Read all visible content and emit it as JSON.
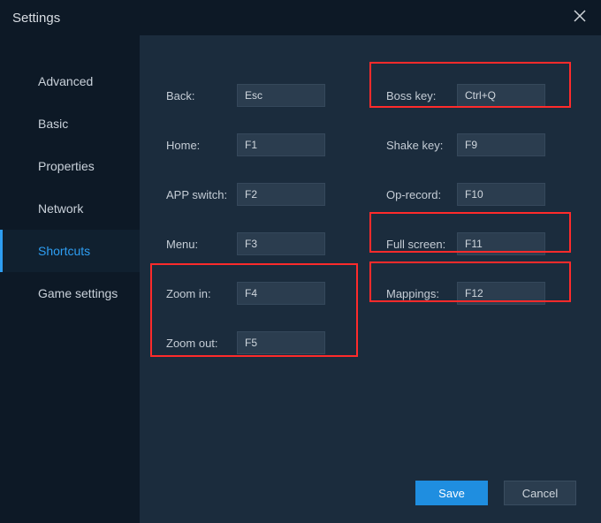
{
  "window": {
    "title": "Settings"
  },
  "sidebar": {
    "items": [
      {
        "label": "Advanced",
        "active": false
      },
      {
        "label": "Basic",
        "active": false
      },
      {
        "label": "Properties",
        "active": false
      },
      {
        "label": "Network",
        "active": false
      },
      {
        "label": "Shortcuts",
        "active": true
      },
      {
        "label": "Game settings",
        "active": false
      }
    ]
  },
  "shortcuts": {
    "left": [
      {
        "label": "Back:",
        "value": "Esc"
      },
      {
        "label": "Home:",
        "value": "F1"
      },
      {
        "label": "APP switch:",
        "value": "F2"
      },
      {
        "label": "Menu:",
        "value": "F3"
      },
      {
        "label": "Zoom in:",
        "value": "F4"
      },
      {
        "label": "Zoom out:",
        "value": "F5"
      }
    ],
    "right": [
      {
        "label": "Boss key:",
        "value": "Ctrl+Q"
      },
      {
        "label": "Shake key:",
        "value": "F9"
      },
      {
        "label": "Op-record:",
        "value": "F10"
      },
      {
        "label": "Full screen:",
        "value": "F11"
      },
      {
        "label": "Mappings:",
        "value": "F12"
      }
    ]
  },
  "footer": {
    "save_label": "Save",
    "cancel_label": "Cancel"
  }
}
